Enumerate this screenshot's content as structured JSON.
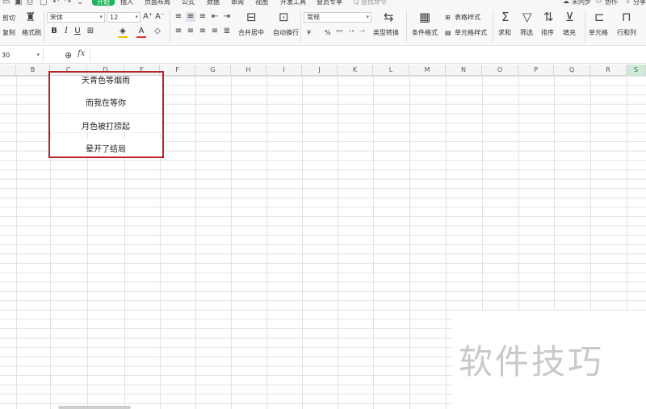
{
  "menubar": {
    "items": [
      "开始",
      "插入",
      "页面布局",
      "公式",
      "数据",
      "审阅",
      "视图",
      "开发工具",
      "会员专享"
    ],
    "active_index": 0,
    "search_hint": "Q 查找命令",
    "right": [
      "未同步",
      "协作",
      "分享"
    ]
  },
  "ribbon": {
    "cut": "剪切",
    "copy": "复制",
    "format_painter": "格式刷",
    "font_name": "宋体",
    "font_size": "12",
    "bold": "B",
    "italic": "I",
    "underline": "U",
    "merge_center": "合并居中",
    "wrap_text": "自动换行",
    "number_format": "常规",
    "currency": "¥",
    "percent": "%",
    "type_convert": "类型转换",
    "conditional_format": "条件格式",
    "table_style": "表格样式",
    "cell_style": "单元格样式",
    "sum": "求和",
    "filter": "筛选",
    "sort": "排序",
    "fill": "填充",
    "cell": "单元格",
    "row_col": "行和列"
  },
  "formula_bar": {
    "name_box": "30",
    "zoom_icon": "search-zoom-icon",
    "fx_label": "fx",
    "value": ""
  },
  "columns": [
    "B",
    "C",
    "D",
    "E",
    "F",
    "G",
    "H",
    "I",
    "J",
    "K",
    "L",
    "M",
    "N",
    "O",
    "P",
    "Q",
    "R",
    "S"
  ],
  "cells": {
    "d1": "天青色等烟雨",
    "d2": "而我在等你",
    "d3": "月色被打捞起",
    "d4": "晕开了结局"
  },
  "watermark": "软件技巧",
  "colors": {
    "selection": "#b8232a",
    "accent": "#1bb35b"
  }
}
